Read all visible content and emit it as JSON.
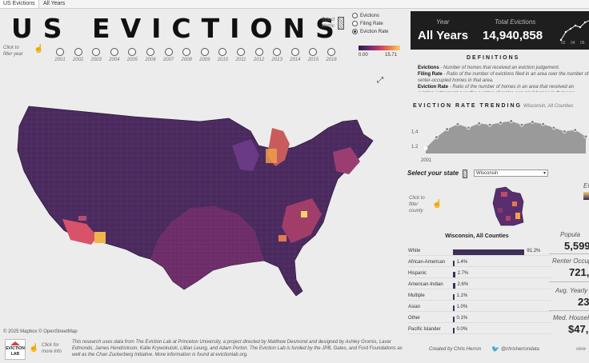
{
  "tabs": [
    {
      "label": "US Evictions",
      "active": true
    },
    {
      "label": "All Years",
      "active": false
    }
  ],
  "title": "US EVICTIONS",
  "metric": {
    "label": "Select Metric",
    "options": [
      "Evictions",
      "Filing Rate",
      "Eviction Rate"
    ],
    "selected": "Eviction Rate",
    "legend_min": "0.00",
    "legend_max": "15.71"
  },
  "year_filter": {
    "label": "Click to filter year",
    "years": [
      "2001",
      "2002",
      "2003",
      "2004",
      "2005",
      "2006",
      "2007",
      "2008",
      "2009",
      "2010",
      "2011",
      "2012",
      "2013",
      "2014",
      "2015",
      "2016"
    ]
  },
  "map_attribution": "© 2025 Mapbox  © OpenStreetMap",
  "footer": {
    "logo_text": "EVICTION LAB",
    "click_info": "Click for more info",
    "research_text": "This research uses data from The Eviction Lab at Princeton University, a project directed by Matthew Desmond and designed by Ashley Gromis, Lavar Edmonds, James Hendrickson, Katie Krywokulski, Lillian Leung, and Adam Porton. The Eviction Lab is funded by the JPB, Gates, and Ford Foundations as well as the Chan Zuckerberg Initiative. More information is found at evictionlab.org.",
    "credit": "Created by Chris Herron",
    "handle": "@chrisherrondata",
    "view_more": "view"
  },
  "summary": {
    "year_label": "Year",
    "year_value": "All Years",
    "total_label": "Total Evictions",
    "total_value": "14,940,858",
    "spark_ticks": [
      "02",
      "04",
      "06"
    ]
  },
  "definitions": {
    "title": "DEFINITIONS",
    "items": [
      {
        "term": "Evictions",
        "text": "- Number of homes that received an eviction judgement."
      },
      {
        "term": "Filing Rate",
        "text": "- Ratio of the number of evictions filed in an area over the number of renter-occupied homes in that area."
      },
      {
        "term": "Eviction Rate",
        "text": "- Ratio of the number of homes in an area that received an eviction judgement over the number of renter-occupied homes in that area."
      }
    ]
  },
  "trending": {
    "title": "EVICTION RATE TRENDING",
    "subtitle": "Wisconsin, All Counties",
    "y_ticks": [
      "1.4",
      "1.2"
    ],
    "x_label_first": "2001"
  },
  "chart_data": {
    "type": "area",
    "title": "EVICTION RATE TRENDING",
    "x": [
      "2001",
      "2002",
      "2003",
      "2004",
      "2005",
      "2006",
      "2007",
      "2008",
      "2009",
      "2010",
      "2011",
      "2012",
      "2013",
      "2014",
      "2015",
      "2016"
    ],
    "values": [
      1.17,
      1.32,
      1.43,
      1.5,
      1.45,
      1.51,
      1.49,
      1.52,
      1.54,
      1.49,
      1.53,
      1.5,
      1.45,
      1.4,
      1.42,
      1.33
    ],
    "ylim": [
      1.1,
      1.6
    ],
    "y_ticks": [
      1.2,
      1.4
    ]
  },
  "state": {
    "label": "Select your state",
    "selected": "Wisconsin",
    "filter_county": "Click to filter county"
  },
  "race": {
    "title": "Wisconsin, All Counties",
    "rows": [
      {
        "label": "White",
        "pct": "91.2%",
        "value": 91.2
      },
      {
        "label": "African-American",
        "pct": "1.4%",
        "value": 1.4
      },
      {
        "label": "Hispanic",
        "pct": "2.7%",
        "value": 2.7
      },
      {
        "label": "American-Indian",
        "pct": "2.6%",
        "value": 2.6
      },
      {
        "label": "Multiple",
        "pct": "1.1%",
        "value": 1.1
      },
      {
        "label": "Asian",
        "pct": "1.0%",
        "value": 1.0
      },
      {
        "label": "Other",
        "pct": "0.1%",
        "value": 0.1
      },
      {
        "label": "Pacific Islander",
        "pct": "0.0%",
        "value": 0.0
      }
    ]
  },
  "stats": {
    "ev_label": "Ev",
    "population_label": "Popula",
    "population_value": "5,599",
    "renter_label": "Renter Occup",
    "renter_value": "721,",
    "yearly_label": "Avg. Yearly",
    "yearly_value": "23",
    "income_label": "Med. Househ",
    "income_value": "$47,"
  },
  "colors": {
    "map_low": "#3b2455",
    "map_mid": "#7a2d6e",
    "map_high": "#f0b64a",
    "bar": "#3e2e5a",
    "dark_panel": "#1e1e1e"
  }
}
